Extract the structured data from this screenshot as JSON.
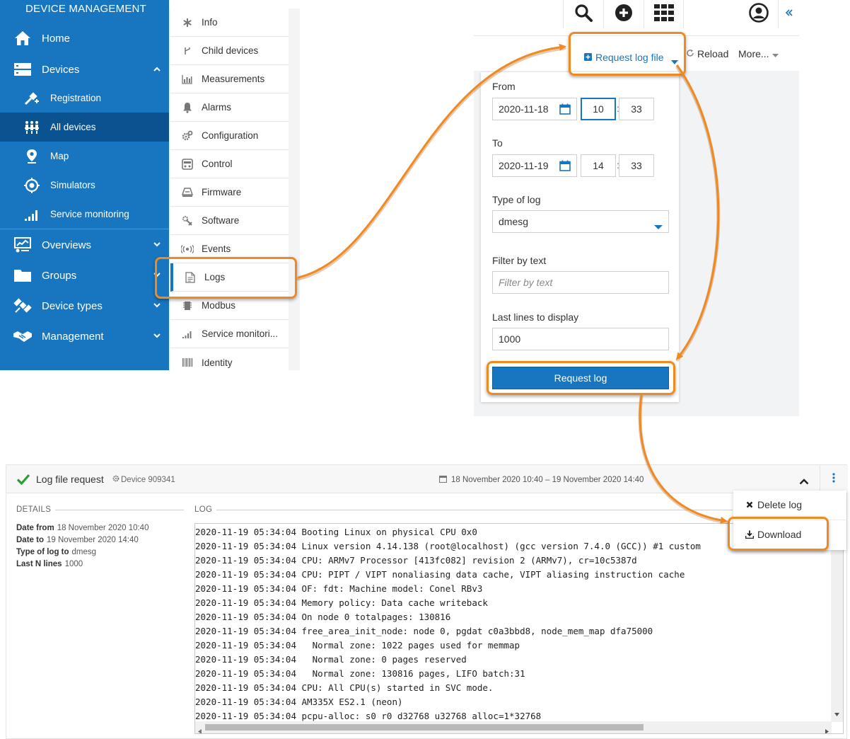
{
  "navigator": {
    "title": "DEVICE MANAGEMENT",
    "home": "Home",
    "devices": "Devices",
    "devices_sub": [
      "Registration",
      "All devices",
      "Map",
      "Simulators",
      "Service monitoring"
    ],
    "overviews": "Overviews",
    "groups": "Groups",
    "device_types": "Device types",
    "management": "Management",
    "colors": {
      "background": "#1776bf",
      "active": "#0b5290"
    }
  },
  "tabs": [
    "Info",
    "Child devices",
    "Measurements",
    "Alarms",
    "Configuration",
    "Control",
    "Firmware",
    "Software",
    "Events",
    "Logs",
    "Modbus",
    "Service monitori...",
    "Identity"
  ],
  "header_icons": [
    "search-icon",
    "plus-circle-icon",
    "app-grid-icon",
    "user-icon",
    "collapse-icon"
  ],
  "action_bar": {
    "request_log_file": "Request log file",
    "reload": "Reload",
    "more": "More..."
  },
  "log_form": {
    "from_label": "From",
    "from_date": "2020-11-18",
    "from_hour": "10",
    "from_minute": "33",
    "to_label": "To",
    "to_date": "2020-11-19",
    "to_hour": "14",
    "to_minute": "33",
    "type_label": "Type of log",
    "type_value": "dmesg",
    "filter_label": "Filter by text",
    "filter_placeholder": "Filter by text",
    "last_lines_label": "Last lines to display",
    "last_lines_value": "1000",
    "submit": "Request log"
  },
  "log_request": {
    "title": "Log file request",
    "device": "Device 909341",
    "date_range": "18 November 2020 10:40 – 19 November 2020 14:40",
    "details_heading": "DETAILS",
    "log_heading": "LOG",
    "details": [
      {
        "label": "Date from",
        "value": "18 November 2020 10:40"
      },
      {
        "label": "Date to",
        "value": "19 November 2020 14:40"
      },
      {
        "label": "Type of log to",
        "value": "dmesg"
      },
      {
        "label": "Last N lines",
        "value": "1000"
      }
    ],
    "log_lines": [
      "2020-11-19 05:34:04 Booting Linux on physical CPU 0x0",
      "2020-11-19 05:34:04 Linux version 4.14.138 (root@localhost) (gcc version 7.4.0 (GCC)) #1 custom",
      "2020-11-19 05:34:04 CPU: ARMv7 Processor [413fc082] revision 2 (ARMv7), cr=10c5387d",
      "2020-11-19 05:34:04 CPU: PIPT / VIPT nonaliasing data cache, VIPT aliasing instruction cache",
      "2020-11-19 05:34:04 OF: fdt: Machine model: Conel RBv3",
      "2020-11-19 05:34:04 Memory policy: Data cache writeback",
      "2020-11-19 05:34:04 On node 0 totalpages: 130816",
      "2020-11-19 05:34:04 free_area_init_node: node 0, pgdat c0a3bbd8, node_mem_map dfa75000",
      "2020-11-19 05:34:04   Normal zone: 1022 pages used for memmap",
      "2020-11-19 05:34:04   Normal zone: 0 pages reserved",
      "2020-11-19 05:34:04   Normal zone: 130816 pages, LIFO batch:31",
      "2020-11-19 05:34:04 CPU: All CPU(s) started in SVC mode.",
      "2020-11-19 05:34:04 AM335X ES2.1 (neon)",
      "2020-11-19 05:34:04 pcpu-alloc: s0 r0 d32768 u32768 alloc=1*32768"
    ]
  },
  "context_menu": {
    "delete": "Delete log",
    "download": "Download"
  },
  "highlight_color": "#ef8a23"
}
